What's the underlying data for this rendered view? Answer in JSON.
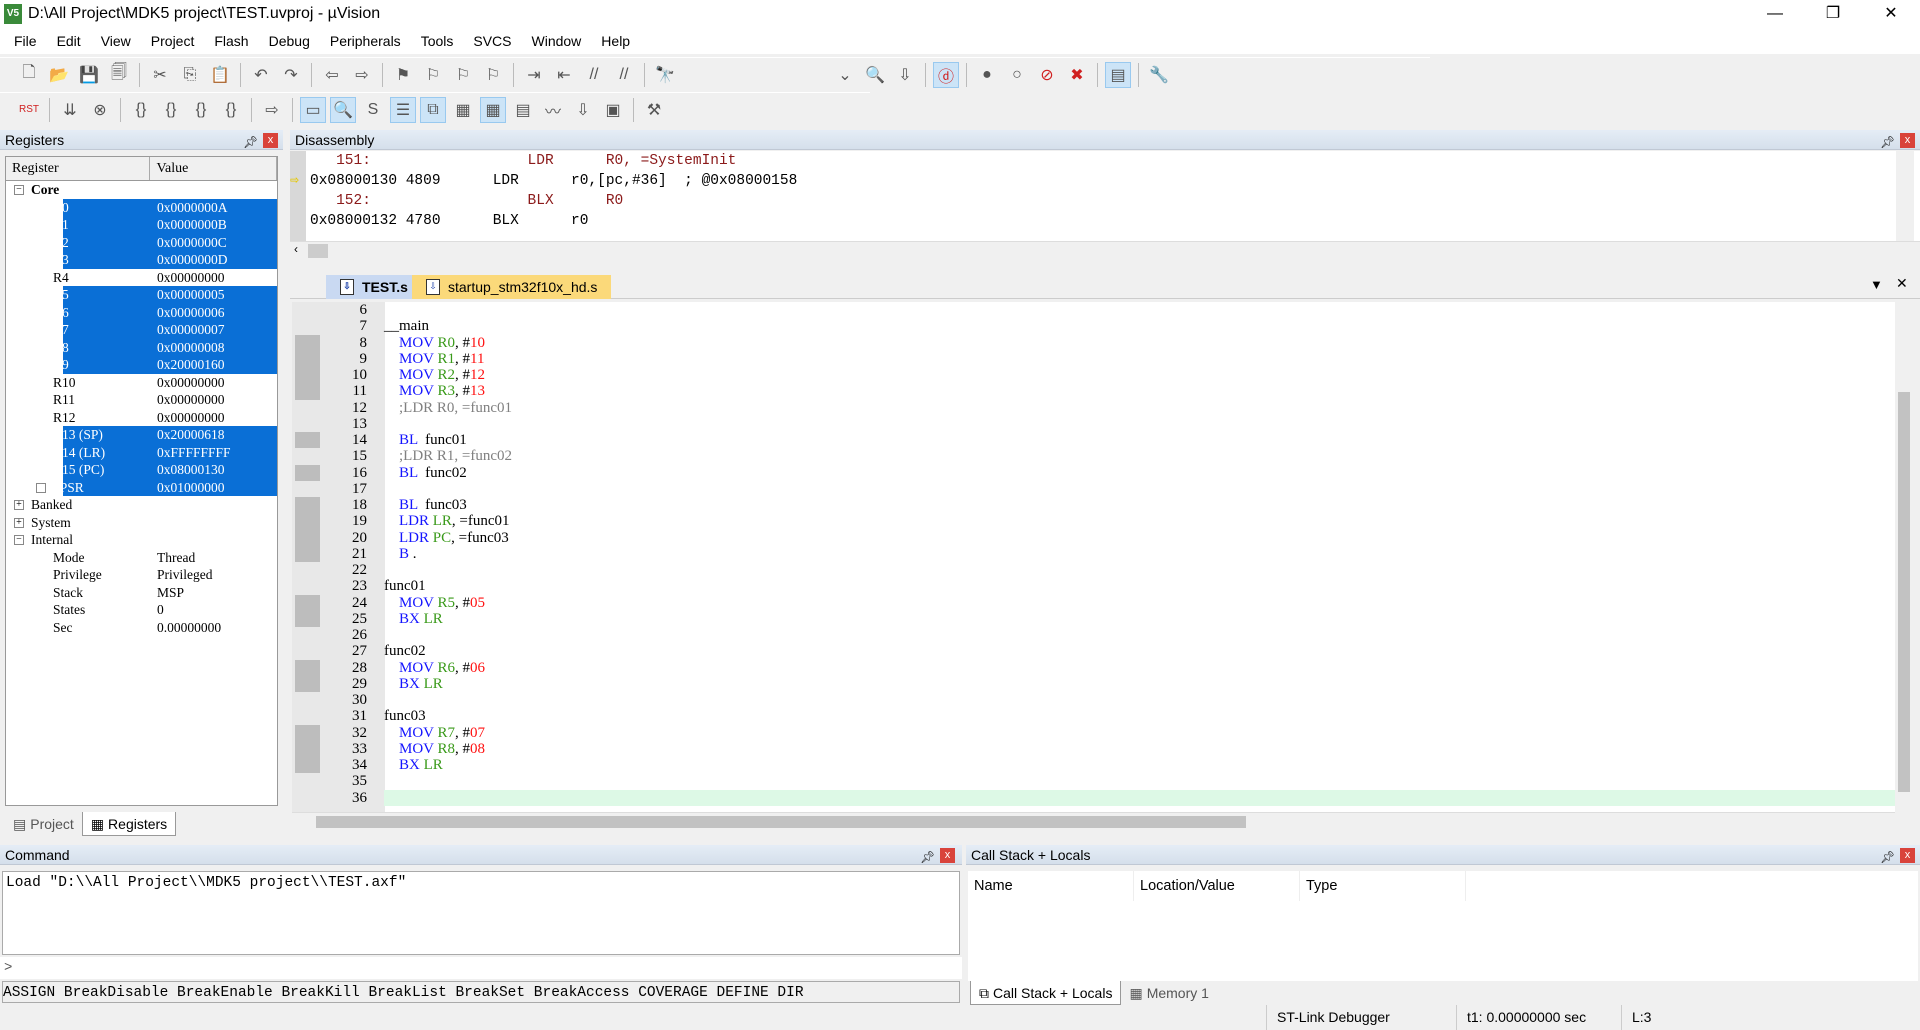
{
  "window": {
    "title": "D:\\All Project\\MDK5 project\\TEST.uvproj - µVision",
    "logo": "V5",
    "min": "—",
    "max": "❐",
    "close": "✕"
  },
  "menu": [
    "File",
    "Edit",
    "View",
    "Project",
    "Flash",
    "Debug",
    "Peripherals",
    "Tools",
    "SVCS",
    "Window",
    "Help"
  ],
  "toolbar1": [
    "new-file",
    "open-file",
    "save",
    "save-all",
    "|",
    "cut",
    "copy",
    "paste",
    "|",
    "undo",
    "redo",
    "|",
    "nav-back",
    "nav-forward",
    "|",
    "bookmark",
    "prev-bookmark",
    "next-bookmark",
    "clear-bookmarks",
    "|",
    "indent",
    "unindent",
    "comment",
    "uncomment",
    "|",
    "find-in-files"
  ],
  "toolbar1b": [
    "dropdown",
    "find",
    "incremental-find",
    "|",
    "debug-session",
    "|",
    "breakpoint",
    "disable-breakpoint",
    "disable-all-breakpoints",
    "kill-all-breakpoints",
    "|",
    "window-layout",
    "|",
    "configure"
  ],
  "toolbar2": [
    "reset",
    "|",
    "run",
    "stop",
    "|",
    "step-into",
    "step-over",
    "step-out",
    "run-to-cursor",
    "|",
    "show-next-statement",
    "|",
    "command-window",
    "disassembly-window",
    "symbols-window",
    "registers-window",
    "call-stack-window",
    "watch-windows",
    "memory-windows",
    "serial-windows",
    "analysis-windows",
    "trace-windows",
    "system-viewer",
    "|",
    "toolbox"
  ],
  "registers": {
    "title": "Registers",
    "col_register": "Register",
    "col_value": "Value",
    "core_label": "Core",
    "core": [
      [
        "R0",
        "0x0000000A",
        1
      ],
      [
        "R1",
        "0x0000000B",
        1
      ],
      [
        "R2",
        "0x0000000C",
        1
      ],
      [
        "R3",
        "0x0000000D",
        1
      ],
      [
        "R4",
        "0x00000000",
        0
      ],
      [
        "R5",
        "0x00000005",
        1
      ],
      [
        "R6",
        "0x00000006",
        1
      ],
      [
        "R7",
        "0x00000007",
        1
      ],
      [
        "R8",
        "0x00000008",
        1
      ],
      [
        "R9",
        "0x20000160",
        1
      ],
      [
        "R10",
        "0x00000000",
        0
      ],
      [
        "R11",
        "0x00000000",
        0
      ],
      [
        "R12",
        "0x00000000",
        0
      ],
      [
        "R13 (SP)",
        "0x20000618",
        1
      ],
      [
        "R14 (LR)",
        "0xFFFFFFFF",
        1
      ],
      [
        "R15 (PC)",
        "0x08000130",
        1
      ],
      [
        "xPSR",
        "0x01000000",
        1
      ]
    ],
    "groups": [
      "Banked",
      "System",
      "Internal"
    ],
    "internal": [
      [
        "Mode",
        "Thread"
      ],
      [
        "Privilege",
        "Privileged"
      ],
      [
        "Stack",
        "MSP"
      ],
      [
        "States",
        "0"
      ],
      [
        "Sec",
        "0.00000000"
      ]
    ],
    "tab_project": "Project",
    "tab_registers": "Registers"
  },
  "disassembly": {
    "title": "Disassembly",
    "lines": [
      {
        "src": true,
        "text": "   151:                  LDR      R0, =SystemInit"
      },
      {
        "src": false,
        "cur": true,
        "text": "0x08000130 4809      LDR      r0,[pc,#36]  ; @0x08000158"
      },
      {
        "src": true,
        "text": "   152:                  BLX      R0"
      },
      {
        "src": false,
        "text": "0x08000132 4780      BLX      r0"
      }
    ]
  },
  "tabs": [
    {
      "label": "TEST.s",
      "active": true
    },
    {
      "label": "startup_stm32f10x_hd.s",
      "active": false
    }
  ],
  "editor": {
    "lines": [
      {
        "n": 6,
        "m": 0,
        "t": []
      },
      {
        "n": 7,
        "m": 0,
        "t": [
          [
            "",
            "__main"
          ]
        ]
      },
      {
        "n": 8,
        "m": 1,
        "t": [
          [
            "",
            "    "
          ],
          [
            "kw",
            "MOV"
          ],
          [
            "reg",
            " R0"
          ],
          [
            "",
            ", #"
          ],
          [
            "num",
            "10"
          ]
        ]
      },
      {
        "n": 9,
        "m": 1,
        "t": [
          [
            "",
            "    "
          ],
          [
            "kw",
            "MOV"
          ],
          [
            "reg",
            " R1"
          ],
          [
            "",
            ", #"
          ],
          [
            "num",
            "11"
          ]
        ]
      },
      {
        "n": 10,
        "m": 1,
        "t": [
          [
            "",
            "    "
          ],
          [
            "kw",
            "MOV"
          ],
          [
            "reg",
            " R2"
          ],
          [
            "",
            ", #"
          ],
          [
            "num",
            "12"
          ]
        ]
      },
      {
        "n": 11,
        "m": 1,
        "t": [
          [
            "",
            "    "
          ],
          [
            "kw",
            "MOV"
          ],
          [
            "reg",
            " R3"
          ],
          [
            "",
            ", #"
          ],
          [
            "num",
            "13"
          ]
        ]
      },
      {
        "n": 12,
        "m": 0,
        "t": [
          [
            "",
            "    "
          ],
          [
            "cm",
            ";LDR R0, =func01"
          ]
        ]
      },
      {
        "n": 13,
        "m": 0,
        "t": []
      },
      {
        "n": 14,
        "m": 1,
        "t": [
          [
            "",
            "    "
          ],
          [
            "kw",
            "BL"
          ],
          [
            "",
            "  func01"
          ]
        ]
      },
      {
        "n": 15,
        "m": 0,
        "t": [
          [
            "",
            "    "
          ],
          [
            "cm",
            ";LDR R1, =func02"
          ]
        ]
      },
      {
        "n": 16,
        "m": 1,
        "t": [
          [
            "",
            "    "
          ],
          [
            "kw",
            "BL"
          ],
          [
            "",
            "  func02"
          ]
        ]
      },
      {
        "n": 17,
        "m": 0,
        "t": []
      },
      {
        "n": 18,
        "m": 1,
        "t": [
          [
            "",
            "    "
          ],
          [
            "kw",
            "BL"
          ],
          [
            "",
            "  func03"
          ]
        ]
      },
      {
        "n": 19,
        "m": 1,
        "t": [
          [
            "",
            "    "
          ],
          [
            "kw",
            "LDR"
          ],
          [
            "reg",
            " LR"
          ],
          [
            "",
            ", =func01"
          ]
        ]
      },
      {
        "n": 20,
        "m": 1,
        "t": [
          [
            "",
            "    "
          ],
          [
            "kw",
            "LDR"
          ],
          [
            "reg",
            " PC"
          ],
          [
            "",
            ", =func03"
          ]
        ]
      },
      {
        "n": 21,
        "m": 1,
        "t": [
          [
            "",
            "    "
          ],
          [
            "kw",
            "B"
          ],
          [
            "",
            " ."
          ]
        ]
      },
      {
        "n": 22,
        "m": 0,
        "t": []
      },
      {
        "n": 23,
        "m": 0,
        "t": [
          [
            "",
            "func01"
          ]
        ]
      },
      {
        "n": 24,
        "m": 1,
        "t": [
          [
            "",
            "    "
          ],
          [
            "kw",
            "MOV"
          ],
          [
            "reg",
            " R5"
          ],
          [
            "",
            ", #"
          ],
          [
            "num",
            "05"
          ]
        ]
      },
      {
        "n": 25,
        "m": 1,
        "t": [
          [
            "",
            "    "
          ],
          [
            "kw",
            "BX"
          ],
          [
            "reg",
            " LR"
          ]
        ]
      },
      {
        "n": 26,
        "m": 0,
        "t": []
      },
      {
        "n": 27,
        "m": 0,
        "t": [
          [
            "",
            "func02"
          ]
        ]
      },
      {
        "n": 28,
        "m": 1,
        "t": [
          [
            "",
            "    "
          ],
          [
            "kw",
            "MOV"
          ],
          [
            "reg",
            " R6"
          ],
          [
            "",
            ", #"
          ],
          [
            "num",
            "06"
          ]
        ]
      },
      {
        "n": 29,
        "m": 1,
        "t": [
          [
            "",
            "    "
          ],
          [
            "kw",
            "BX"
          ],
          [
            "reg",
            " LR"
          ]
        ]
      },
      {
        "n": 30,
        "m": 0,
        "t": []
      },
      {
        "n": 31,
        "m": 0,
        "t": [
          [
            "",
            "func03"
          ]
        ]
      },
      {
        "n": 32,
        "m": 1,
        "t": [
          [
            "",
            "    "
          ],
          [
            "kw",
            "MOV"
          ],
          [
            "reg",
            " R7"
          ],
          [
            "",
            ", #"
          ],
          [
            "num",
            "07"
          ]
        ]
      },
      {
        "n": 33,
        "m": 1,
        "t": [
          [
            "",
            "    "
          ],
          [
            "kw",
            "MOV"
          ],
          [
            "reg",
            " R8"
          ],
          [
            "",
            ", #"
          ],
          [
            "num",
            "08"
          ]
        ]
      },
      {
        "n": 34,
        "m": 1,
        "t": [
          [
            "",
            "    "
          ],
          [
            "kw",
            "BX"
          ],
          [
            "reg",
            " LR"
          ]
        ]
      },
      {
        "n": 35,
        "m": 0,
        "t": []
      },
      {
        "n": 36,
        "m": 0,
        "cur": true,
        "t": []
      }
    ]
  },
  "command": {
    "title": "Command",
    "output": "Load \"D:\\\\All Project\\\\MDK5 project\\\\TEST.axf\"",
    "prompt": ">",
    "input": "",
    "hints": "ASSIGN BreakDisable BreakEnable BreakKill BreakList BreakSet BreakAccess COVERAGE DEFINE DIR"
  },
  "callstack": {
    "title": "Call Stack + Locals",
    "cols": [
      "Name",
      "Location/Value",
      "Type"
    ],
    "tab_callstack": "Call Stack + Locals",
    "tab_memory": "Memory 1"
  },
  "status": {
    "debugger": "ST-Link Debugger",
    "time": "t1: 0.00000000 sec",
    "line": "L:3"
  },
  "colors": {
    "selection": "#0a6fd6",
    "keyword": "#1414ff",
    "register": "#3a9a1a",
    "number": "#ff1010",
    "comment": "#808080",
    "current_line": "#ddf9e6"
  }
}
